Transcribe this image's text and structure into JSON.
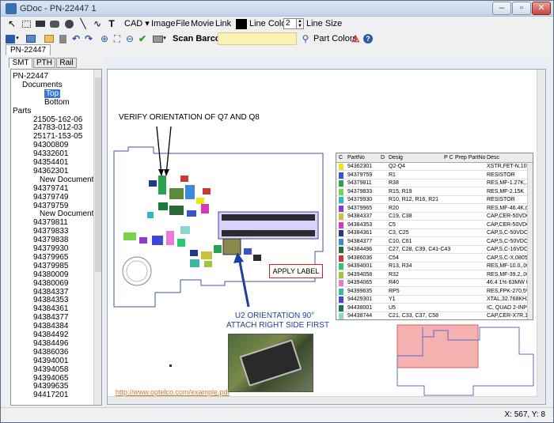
{
  "window": {
    "title": "GDoc - PN-22447 1",
    "minimize": "–",
    "maximize": "▫",
    "close": "✕"
  },
  "toolbar1": {
    "cad": "CAD",
    "image": "Image",
    "file": "File",
    "movie": "Movie",
    "link": "Link",
    "line_color": "Line Color",
    "line_size_value": "2",
    "line_size": "Line Size"
  },
  "toolbar2": {
    "scan_barcode": "Scan Barcode:",
    "scan_value": "",
    "part_colors": "Part Colors"
  },
  "doc_tab": "PN-22447",
  "panel_tabs": [
    "SMT",
    "PTH",
    "Rail"
  ],
  "tree": {
    "root": "PN-22447",
    "documents": "Documents",
    "top": "Top",
    "bottom": "Bottom",
    "parts": "Parts",
    "items": [
      "21505-162-06",
      "24783-012-03",
      "25171-153-05",
      "94300809",
      "94332601",
      "94354401",
      "94362301",
      "New Document",
      "94379741",
      "94379749",
      "94379759",
      "New Document",
      "94379811",
      "94379833",
      "94379838",
      "94379930",
      "94379965",
      "94379985",
      "94380009",
      "94380069",
      "94384337",
      "94384353",
      "94384361",
      "94384377",
      "94384384",
      "94384492",
      "94384496",
      "94386036",
      "94394001",
      "94394058",
      "94394065",
      "94399635",
      "94417201"
    ]
  },
  "canvas": {
    "annotation_verify": "VERIFY ORIENTATION OF Q7 AND Q8",
    "apply_label": "APPLY LABEL",
    "u2_line1": "U2 ORIENTATION 90°",
    "u2_line2": "ATTACH RIGHT SIDE FIRST",
    "link": "http://www.optelco.com/example.pdf"
  },
  "parts_table": {
    "headers": [
      "C",
      "PartNo",
      "D",
      "Desig",
      "P C",
      "Prep PartNo",
      "Desc"
    ],
    "rows": [
      {
        "color": "#f2e21a",
        "partno": "94362301",
        "desig": "Q2-Q4",
        "desc": "XSTR,FET-N,100V, 2/"
      },
      {
        "color": "#3a55c8",
        "partno": "94379759",
        "desig": "R1",
        "desc": "RESISTOR"
      },
      {
        "color": "#2aa050",
        "partno": "94379811",
        "desig": "R38",
        "desc": "RES,MF-1.27K,.063W,"
      },
      {
        "color": "#7ad14a",
        "partno": "94379833",
        "desig": "R15, R19",
        "desc": "RES,MF-2.15K"
      },
      {
        "color": "#2eb8c8",
        "partno": "94379930",
        "desig": "R10, R12, R16, R21",
        "desc": "RESISTOR"
      },
      {
        "color": "#8a3cc4",
        "partno": "94379965",
        "desig": "R20",
        "desc": "RES,MF-46.4K,0.1W,"
      },
      {
        "color": "#c8c23a",
        "partno": "94384337",
        "desig": "C19, C38",
        "desc": "CAP,CER-50VDC,100"
      },
      {
        "color": "#d63ab4",
        "partno": "94384353",
        "desig": "C5",
        "desc": "CAP,CER-50VDC,470"
      },
      {
        "color": "#1f3a8c",
        "partno": "94384361",
        "desig": "C3, C25",
        "desc": "CAP,S,C-50VDC,1000"
      },
      {
        "color": "#3a8ad6",
        "partno": "94384377",
        "desig": "C10, C61",
        "desc": "CAP,S,C-50VDC,4700"
      },
      {
        "color": "#2a6a3a",
        "partno": "94384496",
        "desig": "C27, C28, C39, C41-C43",
        "desc": "CAP,S,C-16VDC,.1UF"
      },
      {
        "color": "#c83a3a",
        "partno": "94386036",
        "desig": "C54",
        "desc": "CAP,S,C-X,0805,16V,"
      },
      {
        "color": "#2ac870",
        "partno": "94394001",
        "desig": "R13, R34",
        "desc": "RES,MF-10.0,.063W,"
      },
      {
        "color": "#9acb3a",
        "partno": "94394058",
        "desig": "R32",
        "desc": "RES,MF-39.2,.063W,"
      },
      {
        "color": "#e87ad8",
        "partno": "94394065",
        "desig": "R40",
        "desc": "46.4 1% 63MW 060"
      },
      {
        "color": "#3ab8a0",
        "partno": "94399635",
        "desig": "RP5",
        "desc": "RES,FPK-270,5%,1/1"
      },
      {
        "color": "#3a4ad6",
        "partno": "94429301",
        "desig": "Y1",
        "desc": "XTAL,32.768KHZ"
      },
      {
        "color": "#1a7a3a",
        "partno": "94438001",
        "desig": "U5",
        "desc": "IC, QUAD 2-INPUT AN"
      },
      {
        "color": "#8ad6c8",
        "partno": "94438744",
        "desig": "C21, C33, C37, C58",
        "desc": "CAP,CER-X7R,1206,5"
      }
    ]
  },
  "status": {
    "coords": "X: 567, Y: 8"
  },
  "colors": {
    "accent": "#3b77d4",
    "highlight_red": "#f4a3a3",
    "label_border": "#cc2222",
    "u2_text": "#1d3fa0"
  }
}
